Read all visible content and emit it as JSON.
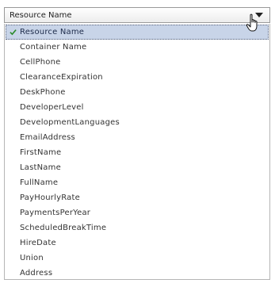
{
  "select": {
    "value": "Resource Name",
    "arrow_icon": "chevron-down-icon",
    "cursor_icon": "hand-pointer-icon"
  },
  "list": {
    "selected_index": 0,
    "check_icon": "checkmark-icon",
    "check_color": "#2a8a2a",
    "selected_bg": "#c8d4e8",
    "items": [
      "Resource Name",
      "Container Name",
      "CellPhone",
      "ClearanceExpiration",
      "DeskPhone",
      "DeveloperLevel",
      "DevelopmentLanguages",
      "EmailAddress",
      "FirstName",
      "LastName",
      "FullName",
      "PayHourlyRate",
      "PaymentsPerYear",
      "ScheduledBreakTime",
      "HireDate",
      "Union",
      "Address"
    ]
  }
}
